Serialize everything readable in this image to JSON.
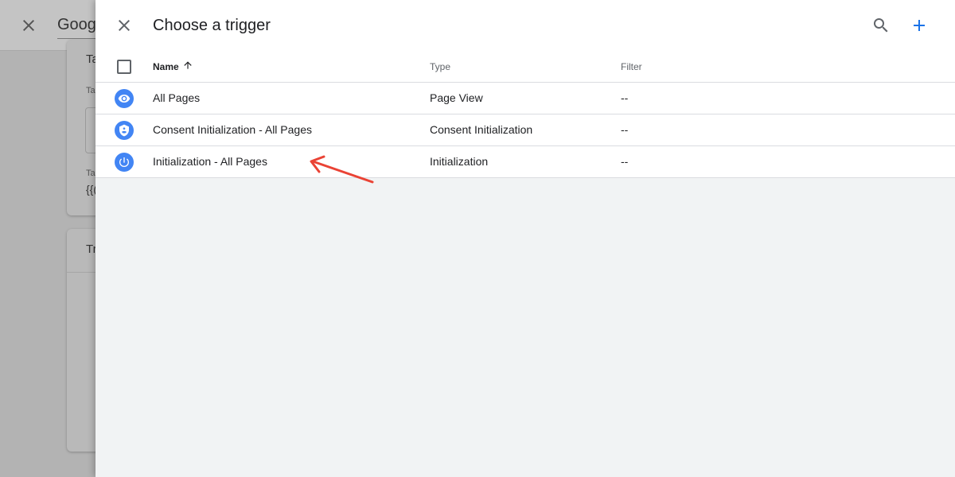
{
  "background": {
    "title": "Goog",
    "card1_title": "Ta",
    "card1_label": "Ta",
    "card1_label2": "Ta",
    "card1_value": "{{(",
    "card2_title": "Tr"
  },
  "panel": {
    "title": "Choose a trigger",
    "close_icon": "close-icon",
    "search_icon": "search-icon",
    "add_icon": "plus-icon",
    "accent_color": "#1a73e8"
  },
  "table": {
    "columns": {
      "name": "Name",
      "type": "Type",
      "filter": "Filter"
    },
    "sort": "ascending",
    "rows": [
      {
        "icon": "eye-icon",
        "name": "All Pages",
        "type": "Page View",
        "filter": "--"
      },
      {
        "icon": "shield-icon",
        "name": "Consent Initialization - All Pages",
        "type": "Consent Initialization",
        "filter": "--"
      },
      {
        "icon": "power-icon",
        "name": "Initialization - All Pages",
        "type": "Initialization",
        "filter": "--"
      }
    ],
    "icon_color": "#4285f4"
  },
  "annotation": {
    "color": "#ea4335"
  }
}
